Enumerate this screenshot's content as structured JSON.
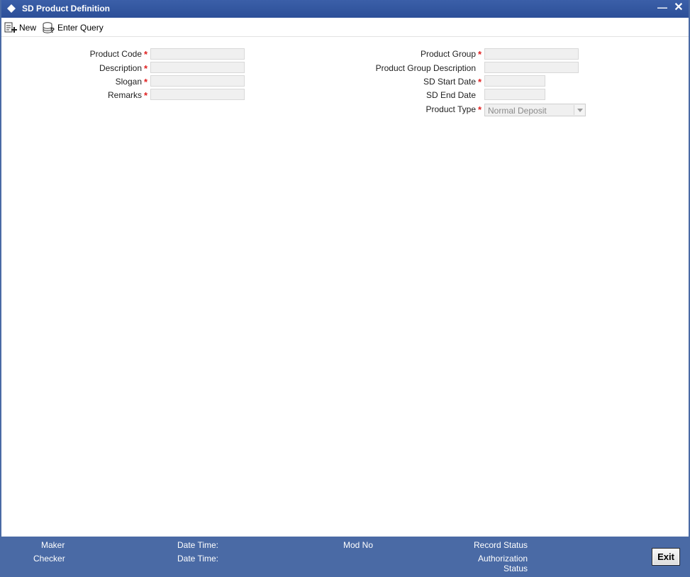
{
  "window": {
    "title": "SD Product Definition"
  },
  "toolbar": {
    "new_label": "New",
    "enter_query_label": "Enter Query"
  },
  "form": {
    "product_code": {
      "label": "Product Code",
      "value": ""
    },
    "description": {
      "label": "Description",
      "value": ""
    },
    "slogan": {
      "label": "Slogan",
      "value": ""
    },
    "remarks": {
      "label": "Remarks",
      "value": ""
    },
    "product_group": {
      "label": "Product Group",
      "value": ""
    },
    "product_group_description": {
      "label": "Product Group Description",
      "value": ""
    },
    "sd_start_date": {
      "label": "SD Start Date",
      "value": ""
    },
    "sd_end_date": {
      "label": "SD End Date",
      "value": ""
    },
    "product_type": {
      "label": "Product Type",
      "value": "Normal Deposit"
    },
    "required_marker": "*"
  },
  "footer": {
    "maker": "Maker",
    "checker": "Checker",
    "date_time_1": "Date Time:",
    "date_time_2": "Date Time:",
    "mod_no": "Mod No",
    "record_status": "Record Status",
    "authorization_line1": "Authorization",
    "authorization_line2": "Status",
    "exit_label": "Exit"
  },
  "colors": {
    "titlebar": "#2c4f98",
    "footer": "#4a6aa5",
    "required": "#e02020"
  },
  "icons": {
    "window": "diamond-icon",
    "new": "new-document-icon",
    "enter_query": "query-database-icon",
    "minimize": "minimize-icon",
    "close": "close-icon"
  }
}
